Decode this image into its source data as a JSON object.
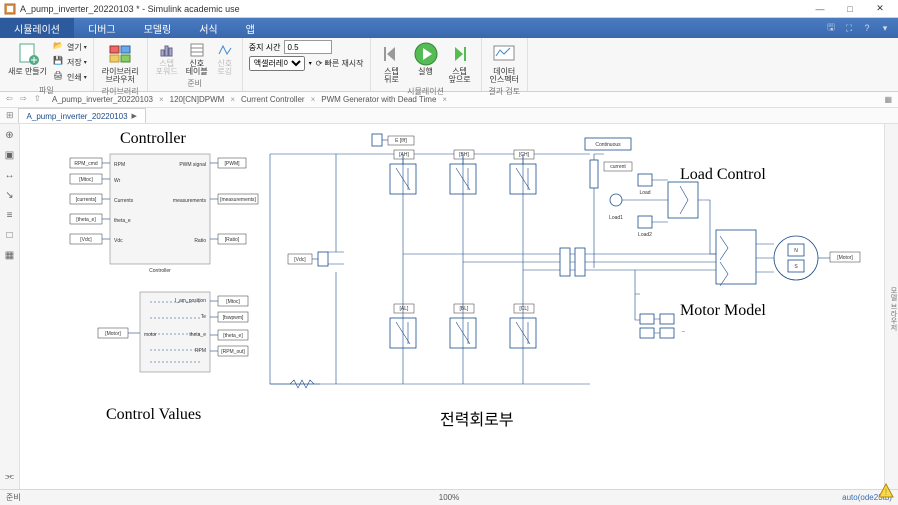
{
  "titlebar": {
    "app_icon": "simulink-icon",
    "title": "A_pump_inverter_20220103 * - Simulink academic use",
    "min": "—",
    "max": "□",
    "close": "✕"
  },
  "menu": {
    "tabs": [
      "시뮬레이션",
      "디버그",
      "모델링",
      "서식",
      "앱"
    ],
    "active": 0
  },
  "ribbon": {
    "group_file": {
      "label": "파일",
      "new": "새로 만들기",
      "open": "열기",
      "save": "저장",
      "print": "인쇄"
    },
    "group_lib": {
      "label": "라이브러리",
      "btn": "라이브러리\n브라우저"
    },
    "group_prep": {
      "label": "준비",
      "btn1": "스텝\n포워드",
      "btn2": "신호\n테이블",
      "btn3": "신호\n로깅"
    },
    "group_sim": {
      "label": "시뮬레이션",
      "stop_lbl": "중지 시간",
      "stop_val": "0.5",
      "mode": "액셀러레이터",
      "step_back": "스텝\n뒤로",
      "run": "실행",
      "step_fwd": "스텝\n앞으로",
      "fast": "빠른 재시작"
    },
    "group_review": {
      "label": "결과 검토",
      "btn": "데이터\n인스펙터"
    }
  },
  "breadcrumb": {
    "items": [
      "A_pump_inverter_20220103",
      "120[CN]DPWM",
      "Current Controller",
      "PWM Generator with Dead Time"
    ]
  },
  "doctab": {
    "label": "A_pump_inverter_20220103"
  },
  "sections": {
    "controller": "Controller",
    "control_values": "Control Values",
    "power": "전력회로부",
    "load": "Load  Control",
    "motor": "Motor  Model"
  },
  "blocks": {
    "controller_name": "Controller",
    "continuous": "Continuous",
    "motor_ns": {
      "n": "N",
      "s": "S"
    }
  },
  "ports": {
    "rpm_cmd": "RPM_cmd",
    "mtoc": "[Mtoc]",
    "currents": "[currents]",
    "theta_e": "[theta_e]",
    "wrdc": "[Vdc]",
    "rpm": "RPM",
    "wr": "Wr",
    "currents2": "Currents",
    "theta_e2": "theta_e",
    "ms": "Vdc",
    "pwm_signal": "PWM signal",
    "measurements": "measurements",
    "ratio": "Ratio",
    "pwm": "[PWM]",
    "measurements2": "[measurements]",
    "ratio2": "[Ratio]",
    "motor_tag": "[Motor]",
    "motor_in": "motor",
    "am_position": "I_am_position",
    "te": "Te",
    "theta_e3": "theta_e",
    "rpm3": "RPM",
    "motoc_out": "[Mtoc]",
    "fswpwm": "[fswpwm]",
    "theta_e_out": "[theta_e]",
    "rpm_out": "[RPM_out]",
    "vdc_tag": "[Vdc]",
    "e_ff": "E [f/f]",
    "ah": "[AH]",
    "bh": "[BH]",
    "ch": "[CH]",
    "al": "[AL]",
    "bl": "[BL]",
    "cl": "[CL]",
    "load1": "Load1",
    "load2": "Load2",
    "load": "Load",
    "current": "current",
    "motor_out": "[Motor]"
  },
  "status": {
    "left": "준비",
    "center": "100%",
    "right": "auto(ode23tb)"
  }
}
